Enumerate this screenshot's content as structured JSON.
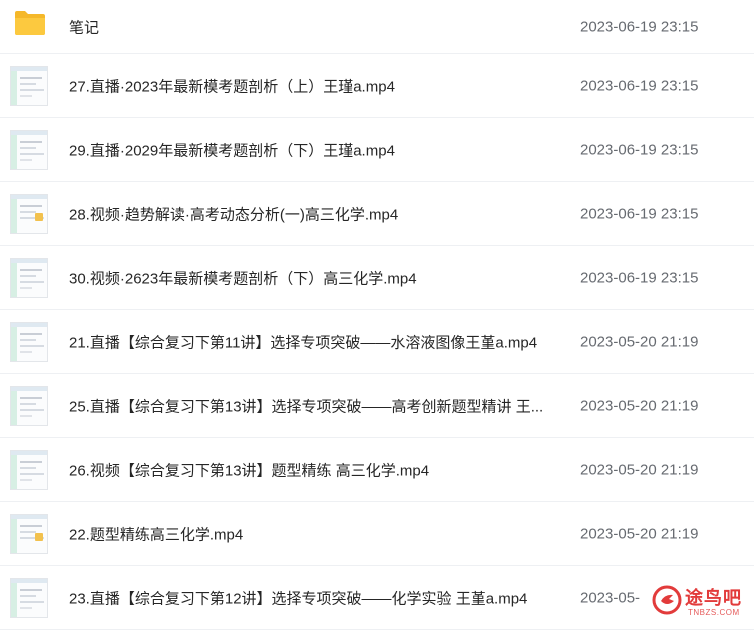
{
  "files": [
    {
      "type": "folder",
      "icon": "folder-icon",
      "name": "笔记",
      "date": "2023-06-19 23:15"
    },
    {
      "type": "video",
      "icon": "video-thumbnail",
      "name": "27.直播·2023年最新模考题剖析（上）王瑾a.mp4",
      "date": "2023-06-19 23:15"
    },
    {
      "type": "video",
      "icon": "video-thumbnail",
      "name": "29.直播·2029年最新模考题剖析（下）王瑾a.mp4",
      "date": "2023-06-19 23:15"
    },
    {
      "type": "video",
      "icon": "video-thumbnail",
      "name": "28.视频·趋势解读·高考动态分析(一)高三化学.mp4",
      "date": "2023-06-19 23:15"
    },
    {
      "type": "video",
      "icon": "video-thumbnail",
      "name": "30.视频·2623年最新模考题剖析（下）高三化学.mp4",
      "date": "2023-06-19 23:15"
    },
    {
      "type": "video",
      "icon": "video-thumbnail",
      "name": "21.直播【综合复习下第11讲】选择专项突破——水溶液图像王堇a.mp4",
      "date": "2023-05-20 21:19"
    },
    {
      "type": "video",
      "icon": "video-thumbnail",
      "name": "25.直播【综合复习下第13讲】选择专项突破——高考创新题型精讲 王...",
      "date": "2023-05-20 21:19"
    },
    {
      "type": "video",
      "icon": "video-thumbnail",
      "name": "26.视频【综合复习下第13讲】题型精练 高三化学.mp4",
      "date": "2023-05-20 21:19"
    },
    {
      "type": "video",
      "icon": "video-thumbnail",
      "name": "22.题型精练高三化学.mp4",
      "date": "2023-05-20 21:19"
    },
    {
      "type": "video",
      "icon": "video-thumbnail",
      "name": "23.直播【综合复习下第12讲】选择专项突破——化学实验 王堇a.mp4",
      "date": "2023-05-"
    }
  ],
  "watermark": {
    "text": "途鸟吧",
    "url": "TNBZS.COM",
    "color": "#e23b3b"
  },
  "colors": {
    "folder": "#f5b82a",
    "text": "#262626",
    "date": "#666a70",
    "divider": "#eef0f3"
  }
}
